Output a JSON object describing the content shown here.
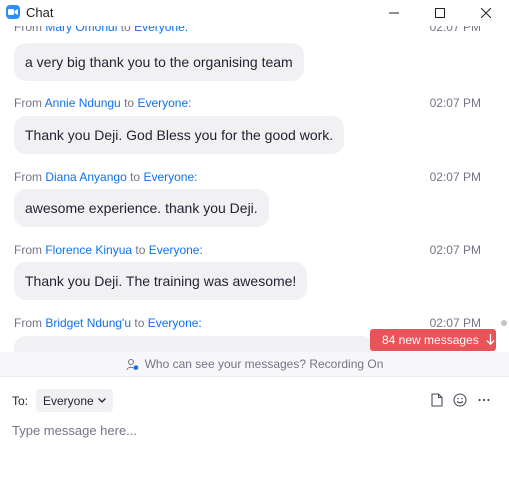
{
  "window": {
    "title": "Chat",
    "app_icon": "zoom-camera-icon",
    "controls": [
      "minimize-icon",
      "maximize-icon",
      "close-icon"
    ]
  },
  "messages": [
    {
      "from_prefix": "From",
      "sender": "Mary Omondi",
      "to_word": "to",
      "recipient": "Everyone:",
      "time": "02:07 PM",
      "text": "a very big thank you to the organising team"
    },
    {
      "from_prefix": "From",
      "sender": "Annie Ndungu",
      "to_word": "to",
      "recipient": "Everyone:",
      "time": "02:07 PM",
      "text": "Thank you Deji. God Bless you for the good work."
    },
    {
      "from_prefix": "From",
      "sender": "Diana Anyango",
      "to_word": "to",
      "recipient": "Everyone:",
      "time": "02:07 PM",
      "text": "awesome experience. thank you Deji."
    },
    {
      "from_prefix": "From",
      "sender": "Florence Kinyua",
      "to_word": "to",
      "recipient": "Everyone:",
      "time": "02:07 PM",
      "text": "Thank you Deji. The training was awesome!"
    },
    {
      "from_prefix": "From",
      "sender": "Bridget Ndung'u",
      "to_word": "to",
      "recipient": "Everyone:",
      "time": "02:07 PM",
      "text": ""
    }
  ],
  "new_messages": {
    "label": "84 new messages",
    "icon": "arrow-down-icon"
  },
  "privacy": {
    "text": "Who can see your messages? Recording On",
    "icon": "people-icon"
  },
  "composer": {
    "to_label": "To:",
    "recipient": "Everyone",
    "placeholder": "Type message here...",
    "tools": [
      "file-icon",
      "emoji-icon",
      "more-icon"
    ]
  },
  "colors": {
    "accent": "#0e72ed",
    "new_messages_bg": "#e8545a",
    "bubble_bg": "#f1f1f4",
    "app_icon": "#2d8cff"
  }
}
